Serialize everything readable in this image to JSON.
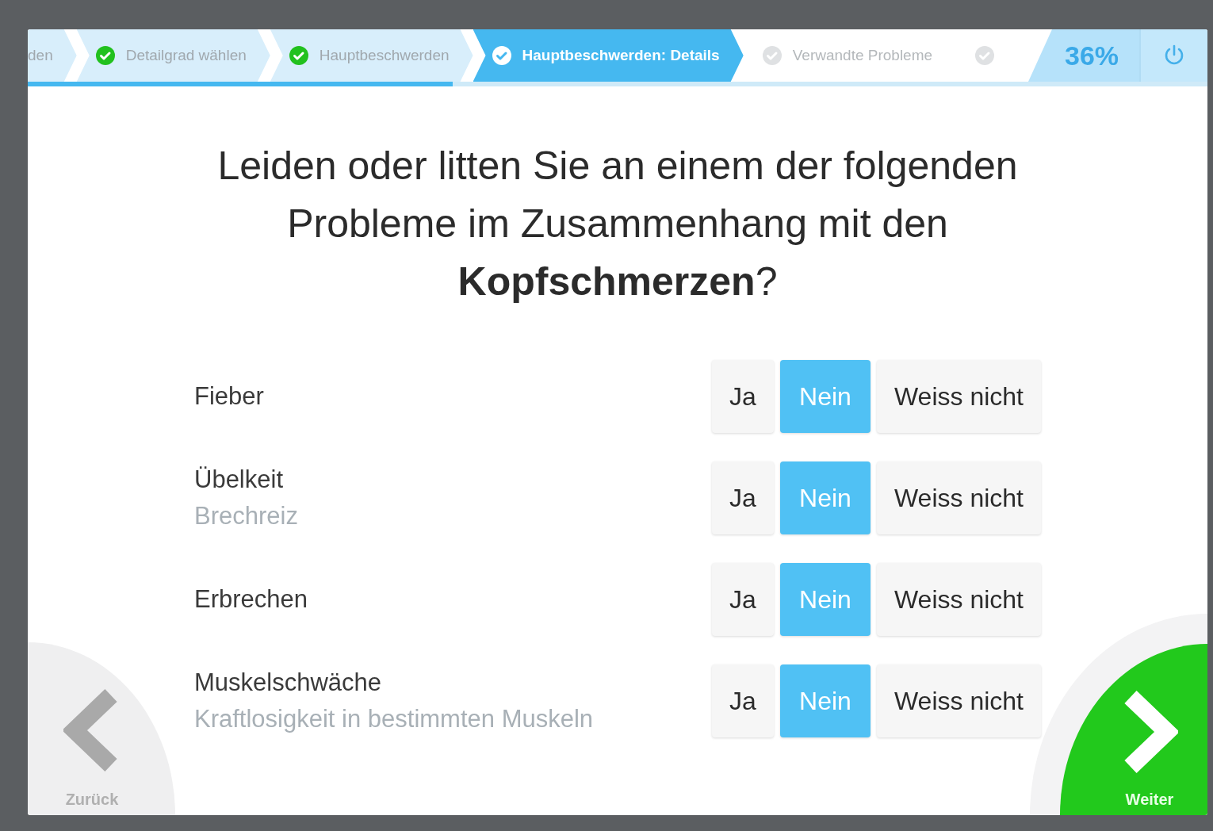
{
  "steps": [
    {
      "label": "den",
      "completed": true,
      "selected": false
    },
    {
      "label": "Detailgrad wählen",
      "completed": true,
      "selected": false
    },
    {
      "label": "Hauptbeschwerden",
      "completed": true,
      "selected": false
    },
    {
      "label": "Hauptbeschwerden: Details",
      "completed": false,
      "selected": true
    },
    {
      "label": "Verwandte Probleme",
      "completed": false,
      "selected": false
    },
    {
      "completed": false,
      "selected": false
    }
  ],
  "progress": {
    "percent": "36%",
    "level": 0.36
  },
  "question": "Leiden oder litten Sie an einem der folgenden Probleme im Zusammenhang mit den **Kopfschmerzen**?",
  "items": [
    {
      "label": "Fieber",
      "options": [
        {
          "label": "Ja",
          "selected": false
        },
        {
          "label": "Nein",
          "selected": true
        },
        {
          "label": "Weiss nicht",
          "selected": false
        }
      ]
    },
    {
      "label": "Übelkeit",
      "hint": "Brechreiz",
      "options": [
        {
          "label": "Ja",
          "selected": false
        },
        {
          "label": "Nein",
          "selected": true
        },
        {
          "label": "Weiss nicht",
          "selected": false
        }
      ]
    },
    {
      "label": "Erbrechen",
      "options": [
        {
          "label": "Ja",
          "selected": false
        },
        {
          "label": "Nein",
          "selected": true
        },
        {
          "label": "Weiss nicht",
          "selected": false
        }
      ]
    },
    {
      "label": "Muskelschwäche",
      "hint": "Kraftlosigkeit in bestimmten Muskeln",
      "options": [
        {
          "label": "Ja",
          "selected": false
        },
        {
          "label": "Nein",
          "selected": true
        },
        {
          "label": "Weiss nicht",
          "selected": false
        }
      ]
    }
  ],
  "back": {
    "label": "Zurück"
  },
  "next": {
    "label": "Weiter"
  }
}
